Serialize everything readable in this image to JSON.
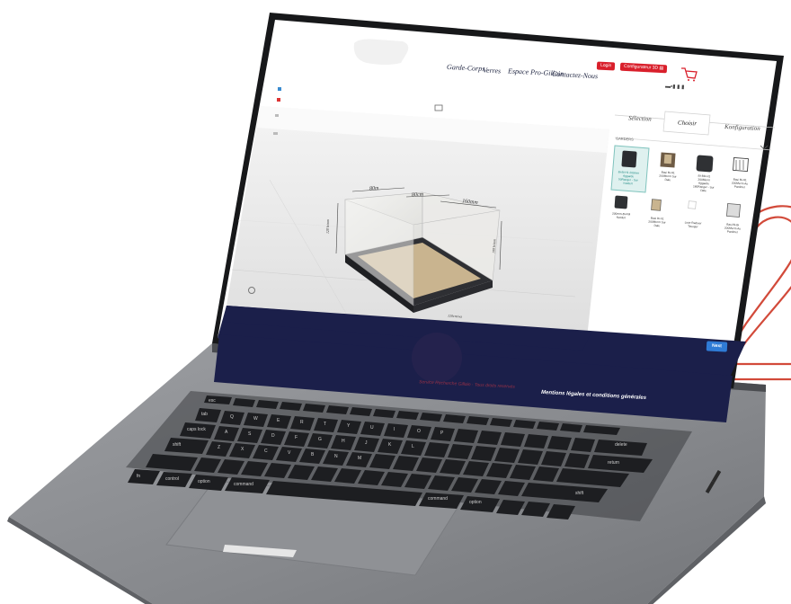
{
  "website": {
    "nav": [
      "Garde-Corps",
      "Verres",
      "Espace Pro-Gillain",
      "Contactez-Nous"
    ],
    "login_label": "Login",
    "configurator_label": "Configurateur 3D ▤",
    "flags_text": "▬▪▮ ▮ ▮",
    "tabs": [
      "Sélection",
      "Choisir",
      "Konfiguration"
    ],
    "category_label": "GARDERS",
    "cards": [
      "Bi-Bi-H1 200mm Aggarde 50Ranger - Sur Nutdert",
      "Basi Bi-H1 200Merm Sur Dale",
      "BI-BD-H1 200Merm Aggarde 180Ranger - Sur Dale",
      "Basi Bi-H1 200Merm Au Pardmet",
      "200mm-Bi-FM Nutdert",
      "Basi Di-h1 200Merm Sur Dale",
      "Liste Radioer Tavoger",
      "Basi Bi-Bi 200Merm Au Pardmet"
    ],
    "dimensions": [
      "80m",
      "80cm",
      "160mm",
      "120 h/mm",
      "100 h/mm",
      "120cm/wz"
    ],
    "next_label": "Next",
    "footer_left": "Service Recherche Gillain · Tous droits reservés",
    "footer_link": "Mentions légales et conditions générales"
  },
  "keyboard": {
    "keys": [
      "esc",
      "tab",
      "caps lock",
      "shift",
      "fn",
      "control",
      "option",
      "command",
      "A",
      "S",
      "D",
      "F",
      "G",
      "H",
      "J",
      "K",
      "L",
      "Q",
      "W",
      "E",
      "R",
      "T",
      "Y",
      "U",
      "I",
      "O",
      "P",
      "Z",
      "X",
      "C",
      "V",
      "B",
      "N",
      "M",
      "delete",
      "return",
      "shift",
      "command",
      "option"
    ]
  },
  "colors": {
    "accent_red": "#d91f2b",
    "footer_navy": "#1b1f4a",
    "next_blue": "#2f7bd6",
    "laptop_gray": "#8d8f93",
    "selected_teal": "#7fc3bd"
  }
}
